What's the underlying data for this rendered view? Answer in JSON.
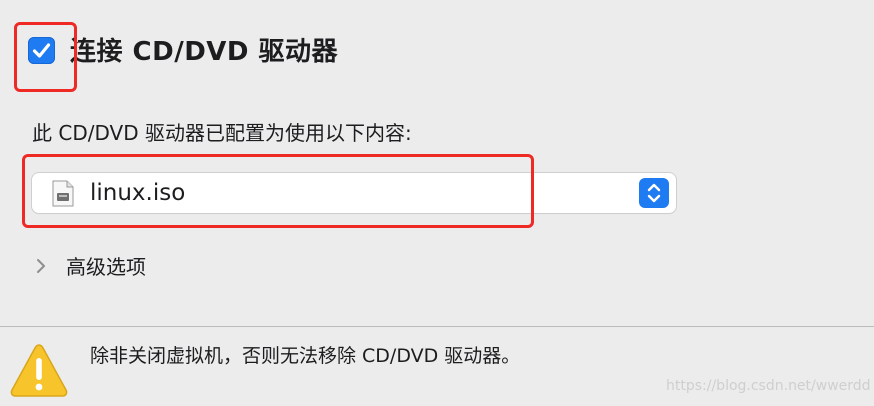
{
  "connect": {
    "checked": true,
    "label": "连接 CD/DVD 驱动器"
  },
  "config": {
    "label": "此 CD/DVD 驱动器已配置为使用以下内容:"
  },
  "media_select": {
    "value": "linux.iso",
    "icon": "disk-image-icon"
  },
  "advanced": {
    "label": "高级选项",
    "expanded": false
  },
  "warning": {
    "icon": "warning-icon",
    "text": "除非关闭虚拟机，否则无法移除 CD/DVD 驱动器。"
  },
  "watermark": "https://blog.csdn.net/wwerdd",
  "colors": {
    "accent": "#1f7bf2",
    "annotation": "#ef2a25",
    "warning": "#f7c42b"
  }
}
